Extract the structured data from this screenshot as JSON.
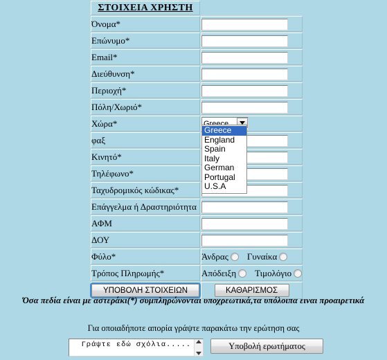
{
  "page": {
    "background_color": "#aed8e6",
    "header_title": "ΣΤΟΙΧΕΙΑ ΧΡΗΣΤΗ"
  },
  "form": {
    "rows": [
      {
        "label": "Όνομα*",
        "type": "text",
        "value": ""
      },
      {
        "label": "Επώνυμο*",
        "type": "text",
        "value": ""
      },
      {
        "label": "Email*",
        "type": "text",
        "value": ""
      },
      {
        "label": "Διεύθυνση*",
        "type": "text",
        "value": ""
      },
      {
        "label": "Περιοχή*",
        "type": "text",
        "value": ""
      },
      {
        "label": "Πόλη/Χωριό*",
        "type": "text",
        "value": ""
      },
      {
        "label": "Χώρα*",
        "type": "select",
        "value": "Greece"
      },
      {
        "label": "φαξ",
        "type": "text",
        "value": ""
      },
      {
        "label": "Κινητό*",
        "type": "text",
        "value": ""
      },
      {
        "label": "Τηλέφωνο*",
        "type": "text",
        "value": ""
      },
      {
        "label": "Ταχυδρομικός κώδικας*",
        "type": "text",
        "value": ""
      },
      {
        "label": "Επάγγελμα ή Δραστηριότητα",
        "type": "text",
        "value": ""
      },
      {
        "label": "ΑΦΜ",
        "type": "text",
        "value": ""
      },
      {
        "label": "ΔΟΥ",
        "type": "text",
        "value": ""
      },
      {
        "label": "Φύλο*",
        "type": "radio",
        "value": ""
      },
      {
        "label": "Τρόπος Πληρωμής*",
        "type": "radio",
        "value": ""
      }
    ],
    "country": {
      "selected": "Greece",
      "expanded": true,
      "highlight_color": "#316ac5",
      "options": [
        "Greece",
        "England",
        "Spain",
        "Italy",
        "German",
        "Portugal",
        "U.S.A"
      ]
    },
    "gender": {
      "option_male": "Άνδρας",
      "option_female": "Γυναίκα",
      "selected": ""
    },
    "payment": {
      "option_receipt": "Απόδειξη",
      "option_invoice": "Τιμολόγιο",
      "selected": ""
    },
    "buttons": {
      "submit": "ΥΠΟΒΟΛΗ ΣΤΟΙΧΕΙΩΝ",
      "reset": "ΚΑΘΑΡΙΣΜΟΣ"
    }
  },
  "notes": {
    "required": "Όσα πεδία είναι με αστεράκι(*) συμπληρώνονται υποχρεωτικά,τα υπόλοιπα ειναι προαιρετικά",
    "question": "Για οποιαδήποτε απορία γράψτε παρακάτω την ερώτηση σας"
  },
  "comment": {
    "text": "Γράψτε εδώ σχόλια.....",
    "submit_label": "Υποβολή ερωτήματος"
  }
}
